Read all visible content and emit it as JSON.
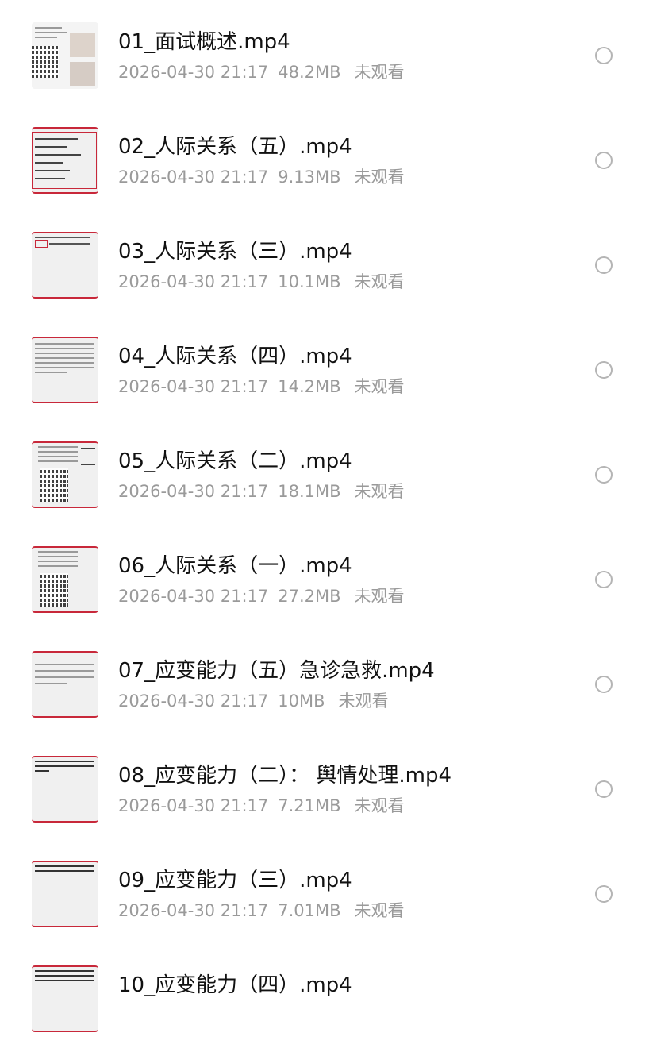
{
  "videos": [
    {
      "title": "01_面试概述.mp4",
      "date": "2026-04-30 21:17",
      "size": "48.2MB",
      "status": "未观看"
    },
    {
      "title": "02_人际关系（五）.mp4",
      "date": "2026-04-30 21:17",
      "size": "9.13MB",
      "status": "未观看"
    },
    {
      "title": "03_人际关系（三）.mp4",
      "date": "2026-04-30 21:17",
      "size": "10.1MB",
      "status": "未观看"
    },
    {
      "title": "04_人际关系（四）.mp4",
      "date": "2026-04-30 21:17",
      "size": "14.2MB",
      "status": "未观看"
    },
    {
      "title": "05_人际关系（二）.mp4",
      "date": "2026-04-30 21:17",
      "size": "18.1MB",
      "status": "未观看"
    },
    {
      "title": "06_人际关系（一）.mp4",
      "date": "2026-04-30 21:17",
      "size": "27.2MB",
      "status": "未观看"
    },
    {
      "title": "07_应变能力（五）急诊急救.mp4",
      "date": "2026-04-30 21:17",
      "size": "10MB",
      "status": "未观看"
    },
    {
      "title": "08_应变能力（二）： 舆情处理.mp4",
      "date": "2026-04-30 21:17",
      "size": "7.21MB",
      "status": "未观看"
    },
    {
      "title": "09_应变能力（三）.mp4",
      "date": "2026-04-30 21:17",
      "size": "7.01MB",
      "status": "未观看"
    },
    {
      "title": "10_应变能力（四）.mp4",
      "date": "",
      "size": "",
      "status": ""
    }
  ],
  "colors": {
    "accent_red": "#c8283a",
    "title_text": "#111111",
    "meta_text": "#9a9a9a",
    "radio_border": "#b5b5b5"
  },
  "icons": {
    "select": "radio-circle-icon",
    "thumbnail": "video-thumbnail"
  }
}
